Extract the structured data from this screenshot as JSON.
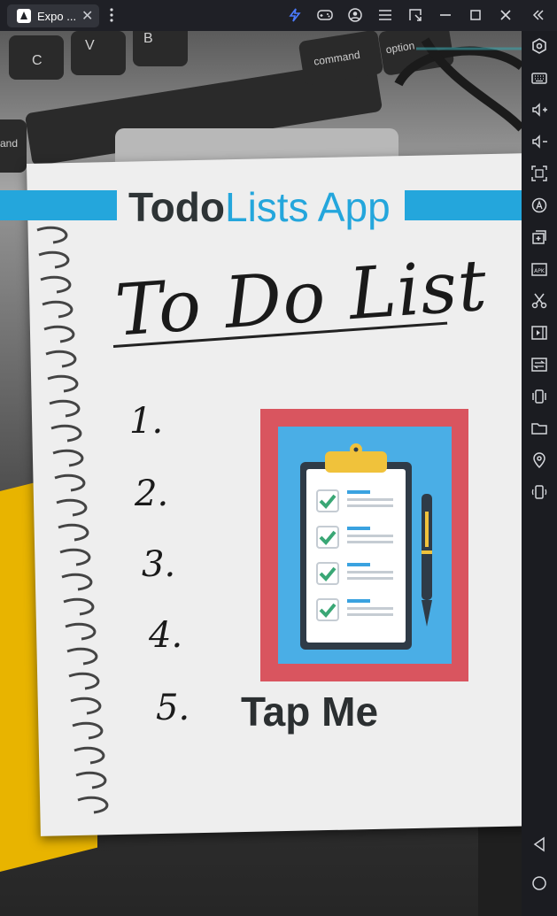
{
  "window": {
    "tab_title": "Expo ...",
    "tab_close": "✕"
  },
  "app": {
    "title_part1": "Todo",
    "title_part2": "Lists App",
    "image_heading": "To Do List",
    "list_numbers": [
      "1.",
      "2.",
      "3.",
      "4.",
      "5."
    ],
    "tap_button_label": "Tap Me"
  },
  "keyboard_keys": [
    "C",
    "V",
    "B",
    "command",
    "option",
    "and"
  ],
  "colors": {
    "accent_blue": "#24a6dc",
    "title_dark": "#2e3436",
    "frame_red": "#d9555f",
    "clipboard_bg": "#4aaee6",
    "check_green": "#3aa775"
  }
}
